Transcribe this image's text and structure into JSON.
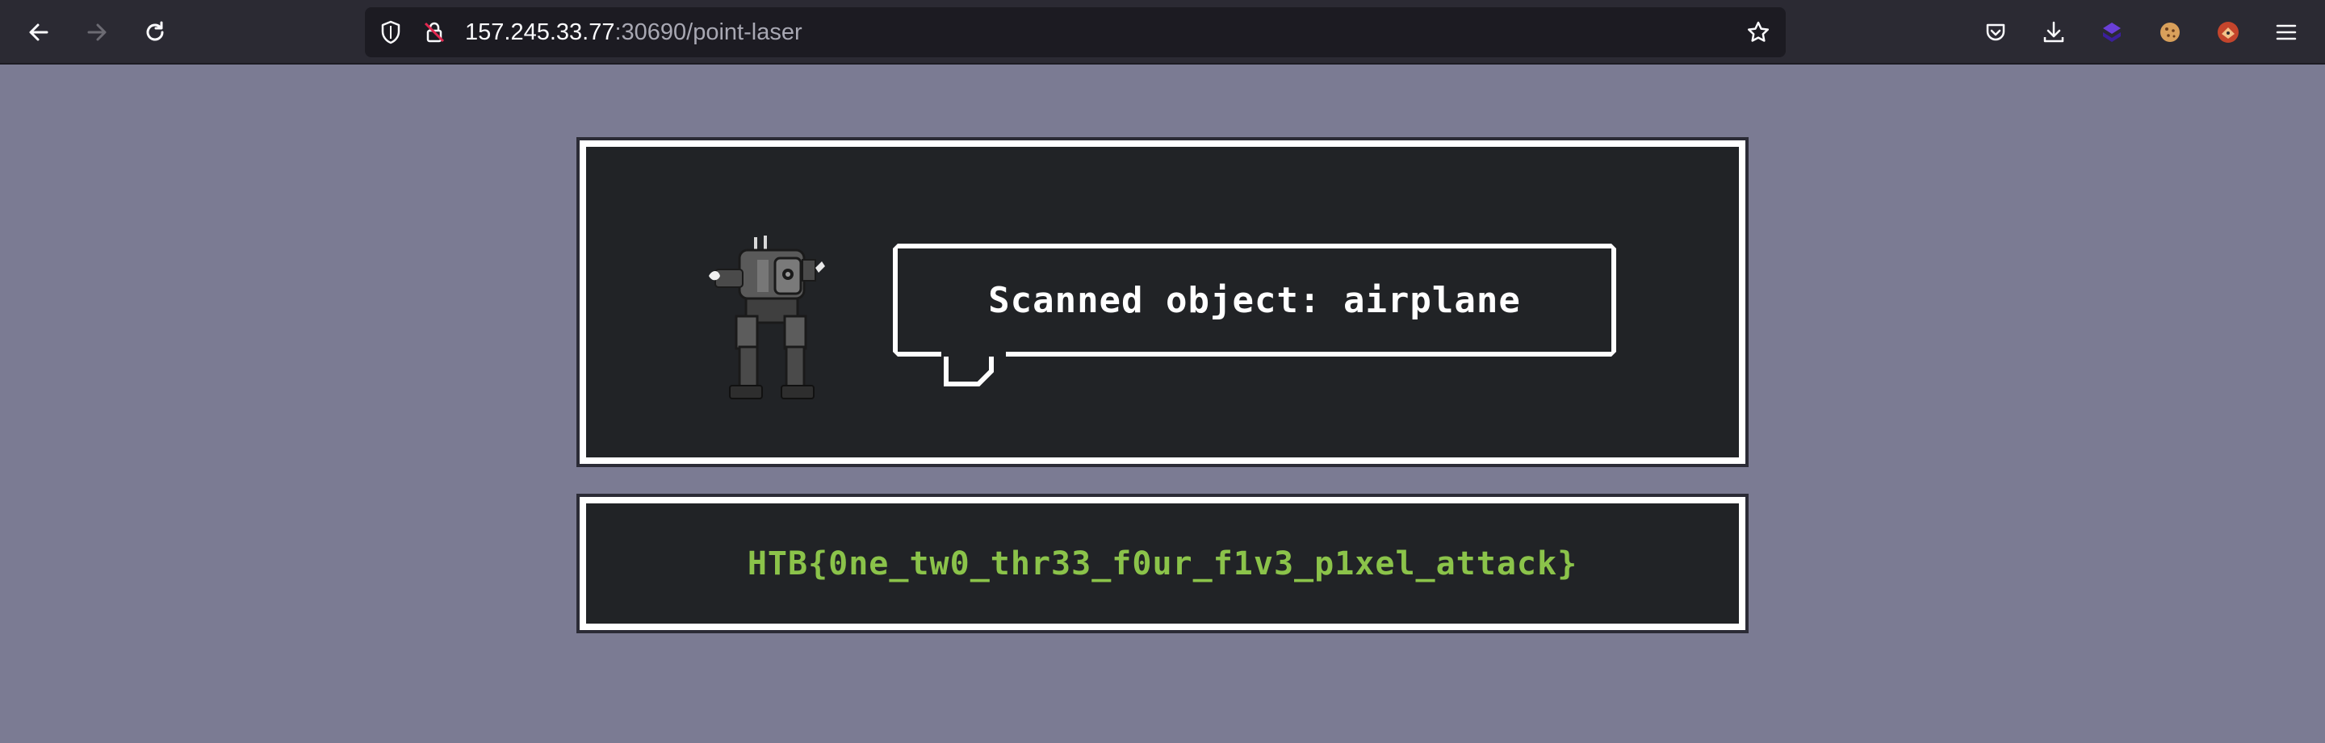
{
  "browser": {
    "url_host": "157.245.33.77",
    "url_rest": ":30690/point-laser",
    "icons": [
      "back-arrow-icon",
      "forward-arrow-icon",
      "reload-icon",
      "shield-icon",
      "insecure-lock-icon",
      "star-icon",
      "pocket-icon",
      "download-icon",
      "extension-icon",
      "cookie-icon",
      "fox-extension-icon",
      "menu-icon"
    ]
  },
  "scan": {
    "message": "Scanned object: airplane"
  },
  "flag": {
    "text": "HTB{0ne_tw0_thr33_f0ur_f1v3_p1xel_attack}"
  },
  "colors": {
    "page_background": "#7b7b93",
    "panel_background": "#212326",
    "flag_green": "#8bc34a",
    "toolbar": "#2b2a33"
  }
}
